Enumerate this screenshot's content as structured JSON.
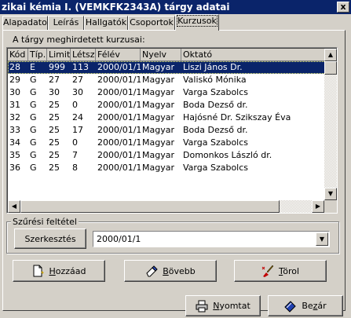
{
  "window": {
    "title": "zikai kémia I. (VEMKFK2343A) tárgy adatai",
    "close": "x"
  },
  "tabs": [
    {
      "label": "Alapadatok"
    },
    {
      "label": "Leírás"
    },
    {
      "label": "Hallgatók"
    },
    {
      "label": "Csoportok"
    },
    {
      "label": "Kurzusok"
    }
  ],
  "list_caption": "A tárgy meghirdetett kurzusai:",
  "columns": [
    "Kód",
    "Típ.",
    "Limit",
    "Létsz.",
    "Félév",
    "Nyelv",
    "Oktató"
  ],
  "rows": [
    [
      "28",
      "E",
      "999",
      "113",
      "2000/01/1",
      "Magyar",
      "Liszi János Dr."
    ],
    [
      "29",
      "G",
      "27",
      "27",
      "2000/01/1",
      "Magyar",
      "Valiskó Mónika"
    ],
    [
      "30",
      "G",
      "30",
      "30",
      "2000/01/1",
      "Magyar",
      "Varga Szabolcs"
    ],
    [
      "31",
      "G",
      "25",
      "0",
      "2000/01/1",
      "Magyar",
      "Boda Dezső dr."
    ],
    [
      "32",
      "G",
      "25",
      "24",
      "2000/01/1",
      "Magyar",
      "Hajósné Dr. Szikszay Éva"
    ],
    [
      "33",
      "G",
      "25",
      "17",
      "2000/01/1",
      "Magyar",
      "Boda Dezső dr."
    ],
    [
      "34",
      "G",
      "25",
      "0",
      "2000/01/1",
      "Magyar",
      "Varga Szabolcs"
    ],
    [
      "35",
      "G",
      "25",
      "7",
      "2000/01/1",
      "Magyar",
      "Domonkos László dr."
    ],
    [
      "36",
      "G",
      "25",
      "8",
      "2000/01/1",
      "Magyar",
      "Varga Szabolcs"
    ]
  ],
  "filter": {
    "group_label": "Szűrési feltétel",
    "edit_button": "Szerkesztés",
    "semester_value": "2000/01/1"
  },
  "buttons": {
    "add": {
      "key": "H",
      "rest": "ozzáad",
      "icon": "new-document-icon"
    },
    "more": {
      "key": "B",
      "rest": "övebb",
      "icon": "edit-eraser-icon"
    },
    "delete": {
      "key": "T",
      "rest": "örol",
      "icon": "delete-brush-icon"
    },
    "print": {
      "key": "N",
      "rest": "yomtat",
      "icon": "printer-icon"
    },
    "close": {
      "key": "z",
      "pre": "Be",
      "rest": "ár",
      "icon": "close-book-icon"
    }
  },
  "colors": {
    "selection": "#0a246a",
    "face": "#d4d0c8"
  }
}
